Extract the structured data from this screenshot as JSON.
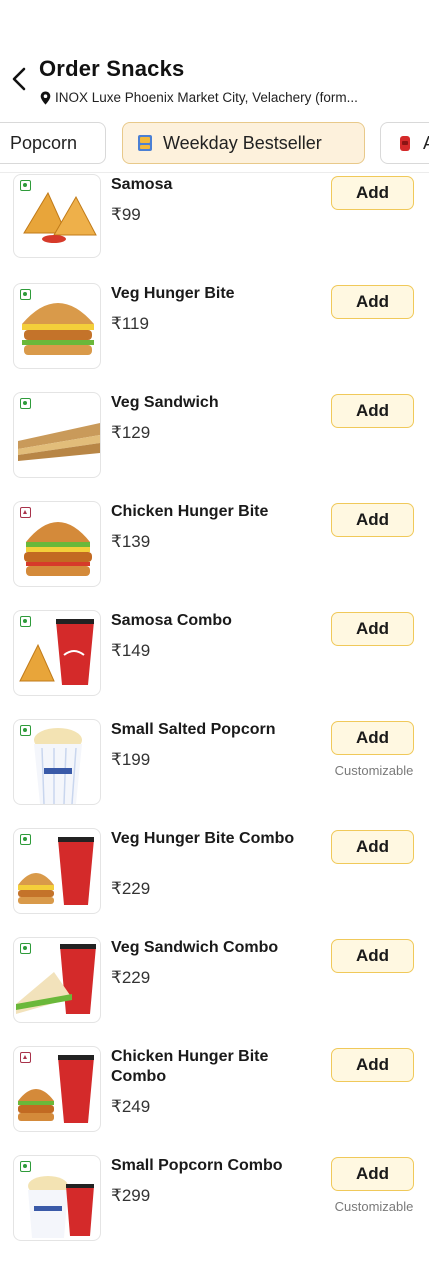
{
  "header": {
    "title": "Order Snacks",
    "location": "INOX Luxe Phoenix Market City, Velachery  (form..."
  },
  "tabs": [
    {
      "label": "Popcorn",
      "active": false
    },
    {
      "label": "Weekday Bestseller",
      "active": true
    },
    {
      "label": "A",
      "active": false
    }
  ],
  "items": [
    {
      "name": "Samosa",
      "price": "₹99",
      "type": "veg",
      "add_label": "Add",
      "note": ""
    },
    {
      "name": "Veg Hunger Bite",
      "price": "₹119",
      "type": "veg",
      "add_label": "Add",
      "note": ""
    },
    {
      "name": "Veg Sandwich",
      "price": "₹129",
      "type": "veg",
      "add_label": "Add",
      "note": ""
    },
    {
      "name": "Chicken Hunger Bite",
      "price": "₹139",
      "type": "nonveg",
      "add_label": "Add",
      "note": ""
    },
    {
      "name": "Samosa Combo",
      "price": "₹149",
      "type": "veg",
      "add_label": "Add",
      "note": ""
    },
    {
      "name": "Small Salted Popcorn",
      "price": "₹199",
      "type": "veg",
      "add_label": "Add",
      "note": "Customizable"
    },
    {
      "name": "Veg Hunger Bite Combo",
      "price": "₹229",
      "type": "veg",
      "add_label": "Add",
      "note": ""
    },
    {
      "name": "Veg Sandwich Combo",
      "price": "₹229",
      "type": "veg",
      "add_label": "Add",
      "note": ""
    },
    {
      "name": "Chicken Hunger Bite Combo",
      "price": "₹249",
      "type": "nonveg",
      "add_label": "Add",
      "note": ""
    },
    {
      "name": "Small Popcorn Combo",
      "price": "₹299",
      "type": "veg",
      "add_label": "Add",
      "note": "Customizable"
    }
  ],
  "colors": {
    "veg": "#2e9b3a",
    "nonveg": "#a8324a",
    "add_border": "#f0c95a",
    "add_bg": "#fff8e1",
    "active_tab_bg": "#fdf1dc"
  }
}
